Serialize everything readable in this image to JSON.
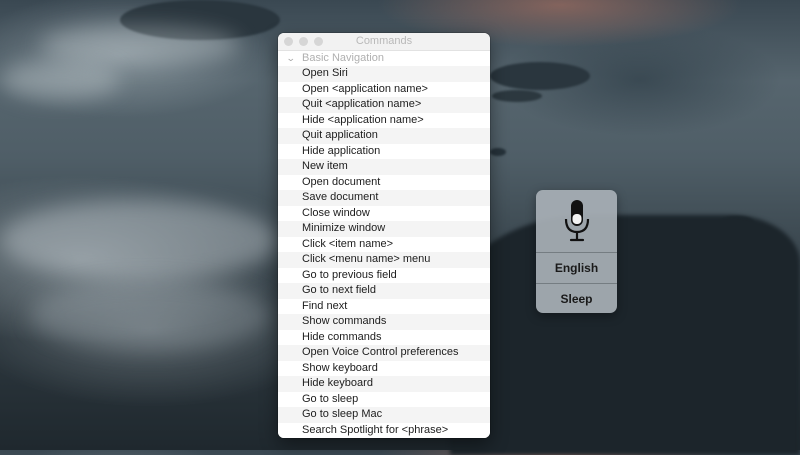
{
  "commands_window": {
    "title": "Commands",
    "section": "Basic Navigation",
    "commands": [
      "Open Siri",
      "Open <application name>",
      "Quit <application name>",
      "Hide <application name>",
      "Quit application",
      "Hide application",
      "New item",
      "Open document",
      "Save document",
      "Close window",
      "Minimize window",
      "Click <item name>",
      "Click <menu name> menu",
      "Go to previous field",
      "Go to next field",
      "Find next",
      "Show commands",
      "Hide commands",
      "Open Voice Control preferences",
      "Show keyboard",
      "Hide keyboard",
      "Go to sleep",
      "Go to sleep Mac",
      "Search Spotlight for <phrase>"
    ]
  },
  "voice_control": {
    "icon": "microphone-icon",
    "language": "English",
    "sleep": "Sleep"
  }
}
